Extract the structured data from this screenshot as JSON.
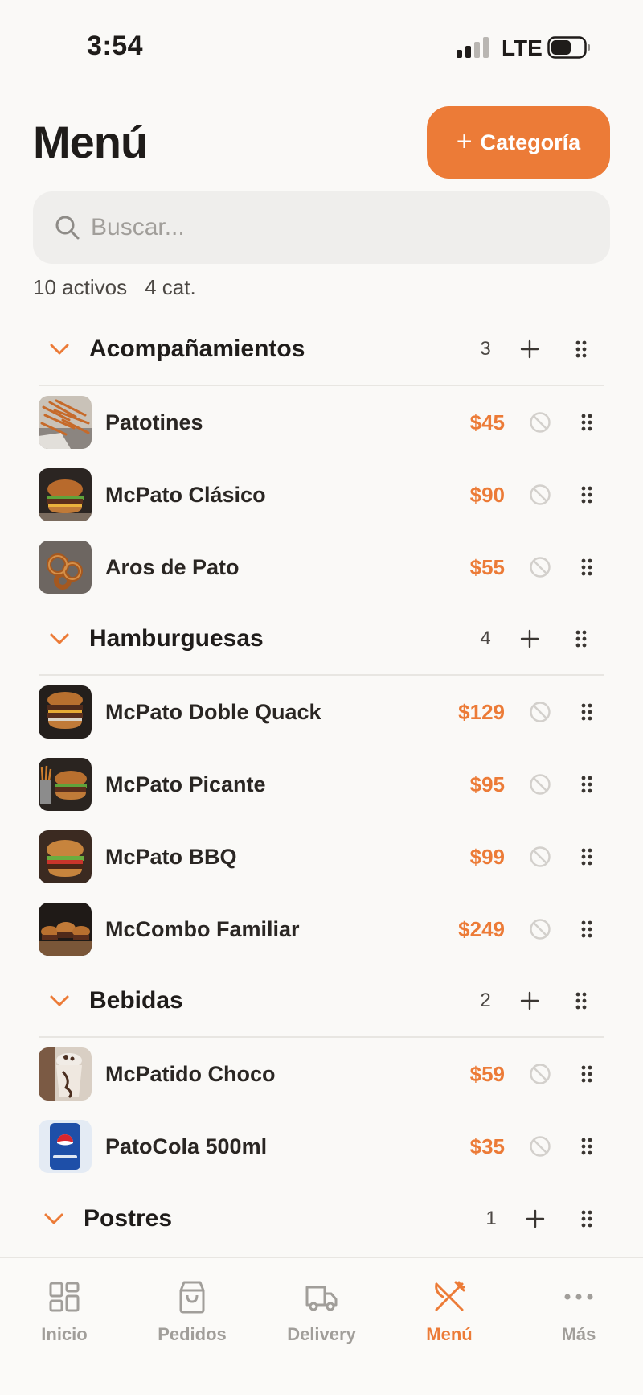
{
  "status_bar": {
    "time": "3:54",
    "network": "LTE"
  },
  "header": {
    "title": "Menú",
    "add_category_label": "Categoría"
  },
  "search": {
    "placeholder": "Buscar..."
  },
  "summary": {
    "active": "10 activos",
    "categories": "4 cat."
  },
  "categories": [
    {
      "name": "Acompañamientos",
      "count": "3",
      "items": [
        {
          "name": "Patotines",
          "price": "$45",
          "image": "fries-photo"
        },
        {
          "name": "McPato Clásico",
          "price": "$90",
          "image": "burger-photo"
        },
        {
          "name": "Aros de Pato",
          "price": "$55",
          "image": "onion-rings-photo"
        }
      ]
    },
    {
      "name": "Hamburguesas",
      "count": "4",
      "items": [
        {
          "name": "McPato Doble Quack",
          "price": "$129",
          "image": "double-burger-photo"
        },
        {
          "name": "McPato Picante",
          "price": "$95",
          "image": "spicy-burger-photo"
        },
        {
          "name": "McPato BBQ",
          "price": "$99",
          "image": "bbq-burger-photo"
        },
        {
          "name": "McCombo Familiar",
          "price": "$249",
          "image": "family-combo-photo"
        }
      ]
    },
    {
      "name": "Bebidas",
      "count": "2",
      "items": [
        {
          "name": "McPatido Choco",
          "price": "$59",
          "image": "milkshake-photo"
        },
        {
          "name": "PatoCola 500ml",
          "price": "$35",
          "image": "soda-can-photo"
        }
      ]
    },
    {
      "name": "Postres",
      "count": "1",
      "items": []
    }
  ],
  "tabs": [
    {
      "label": "Inicio",
      "icon": "grid-icon",
      "active": false
    },
    {
      "label": "Pedidos",
      "icon": "bag-icon",
      "active": false
    },
    {
      "label": "Delivery",
      "icon": "truck-icon",
      "active": false
    },
    {
      "label": "Menú",
      "icon": "fork-knife-icon",
      "active": true
    },
    {
      "label": "Más",
      "icon": "more-icon",
      "active": false
    }
  ],
  "colors": {
    "accent": "#ec7b37",
    "background": "#faf9f7",
    "text": "#1f1c1a",
    "muted": "#a19e9a"
  }
}
